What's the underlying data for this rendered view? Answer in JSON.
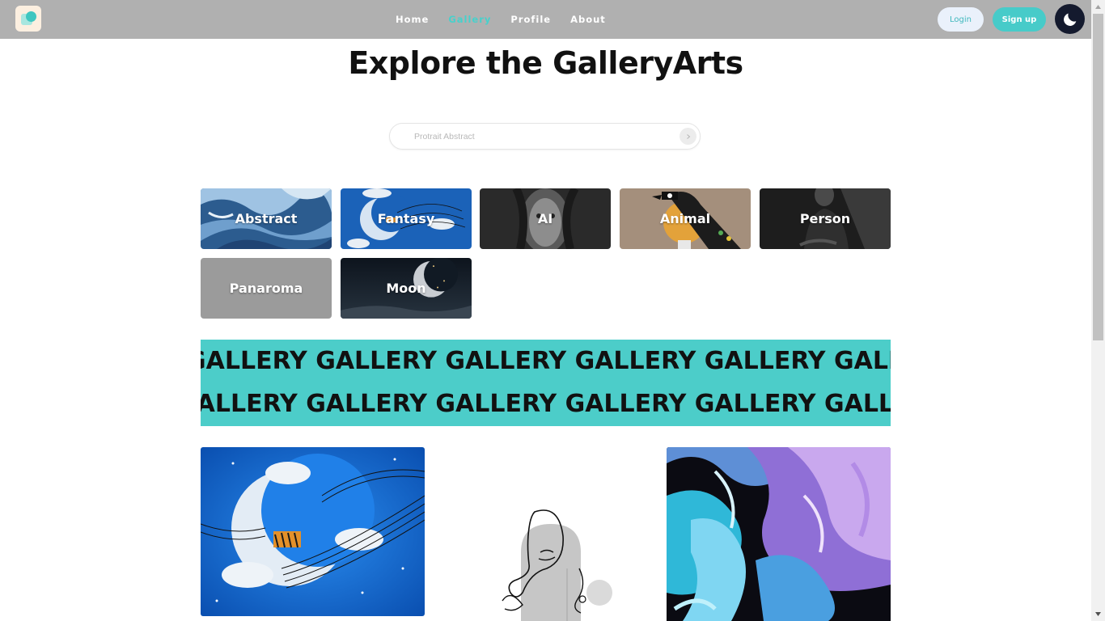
{
  "nav": {
    "links": [
      {
        "label": "Home",
        "active": false
      },
      {
        "label": "Gallery",
        "active": true
      },
      {
        "label": "Profile",
        "active": false
      },
      {
        "label": "About",
        "active": false
      }
    ],
    "login_label": "Login",
    "signup_label": "Sign up",
    "theme_icon": "moon-icon"
  },
  "title": "Explore the GalleryArts",
  "search": {
    "placeholder": "Protrait Abstract",
    "value": "",
    "button_icon": "arrow-right-icon"
  },
  "categories": [
    {
      "label": "Abstract"
    },
    {
      "label": "Fantasy"
    },
    {
      "label": "AI"
    },
    {
      "label": "Animal"
    },
    {
      "label": "Person"
    },
    {
      "label": "Panaroma"
    },
    {
      "label": "Moon"
    }
  ],
  "marquee": {
    "line1": "GALLERY GALLERY GALLERY GALLERY GALLERY GALLERY GALLERY",
    "line2": "GALLERY GALLERY GALLERY GALLERY GALLERY GALLERY GALLERY"
  },
  "colors": {
    "accent": "#47d1cc",
    "navbar": "#b0b0b0",
    "marquee_bg": "#4ccdc9",
    "dark_toggle": "#141a2e"
  }
}
